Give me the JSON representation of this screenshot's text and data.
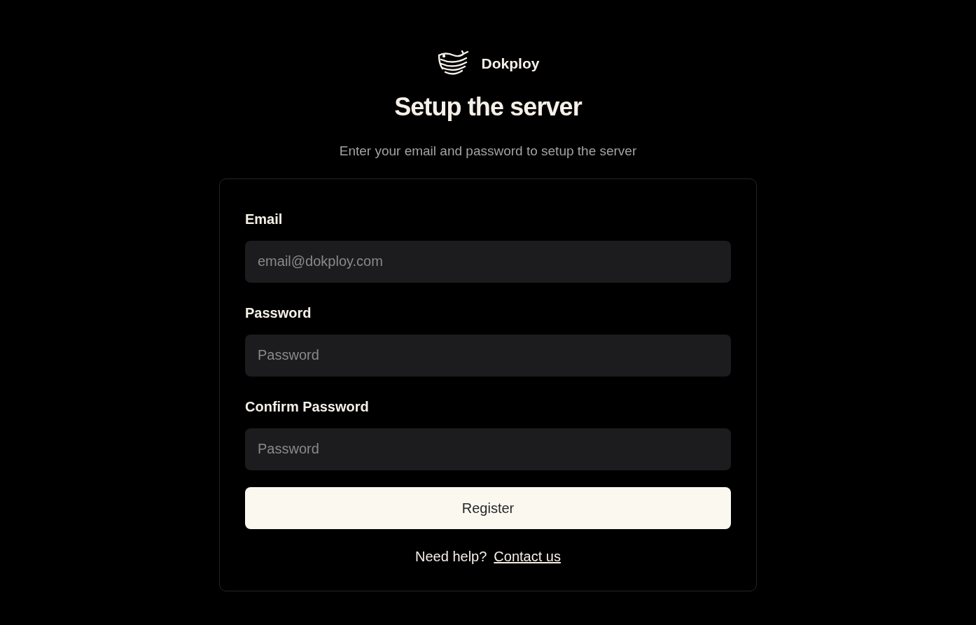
{
  "brand": {
    "name": "Dokploy"
  },
  "heading": "Setup the server",
  "subtitle": "Enter your email and password to setup the server",
  "fields": [
    {
      "label": "Email",
      "placeholder": "email@dokploy.com"
    },
    {
      "label": "Password",
      "placeholder": "Password"
    },
    {
      "label": "Confirm Password",
      "placeholder": "Password"
    }
  ],
  "button": "Register",
  "help": {
    "text": "Need help?",
    "link": "Contact us"
  }
}
